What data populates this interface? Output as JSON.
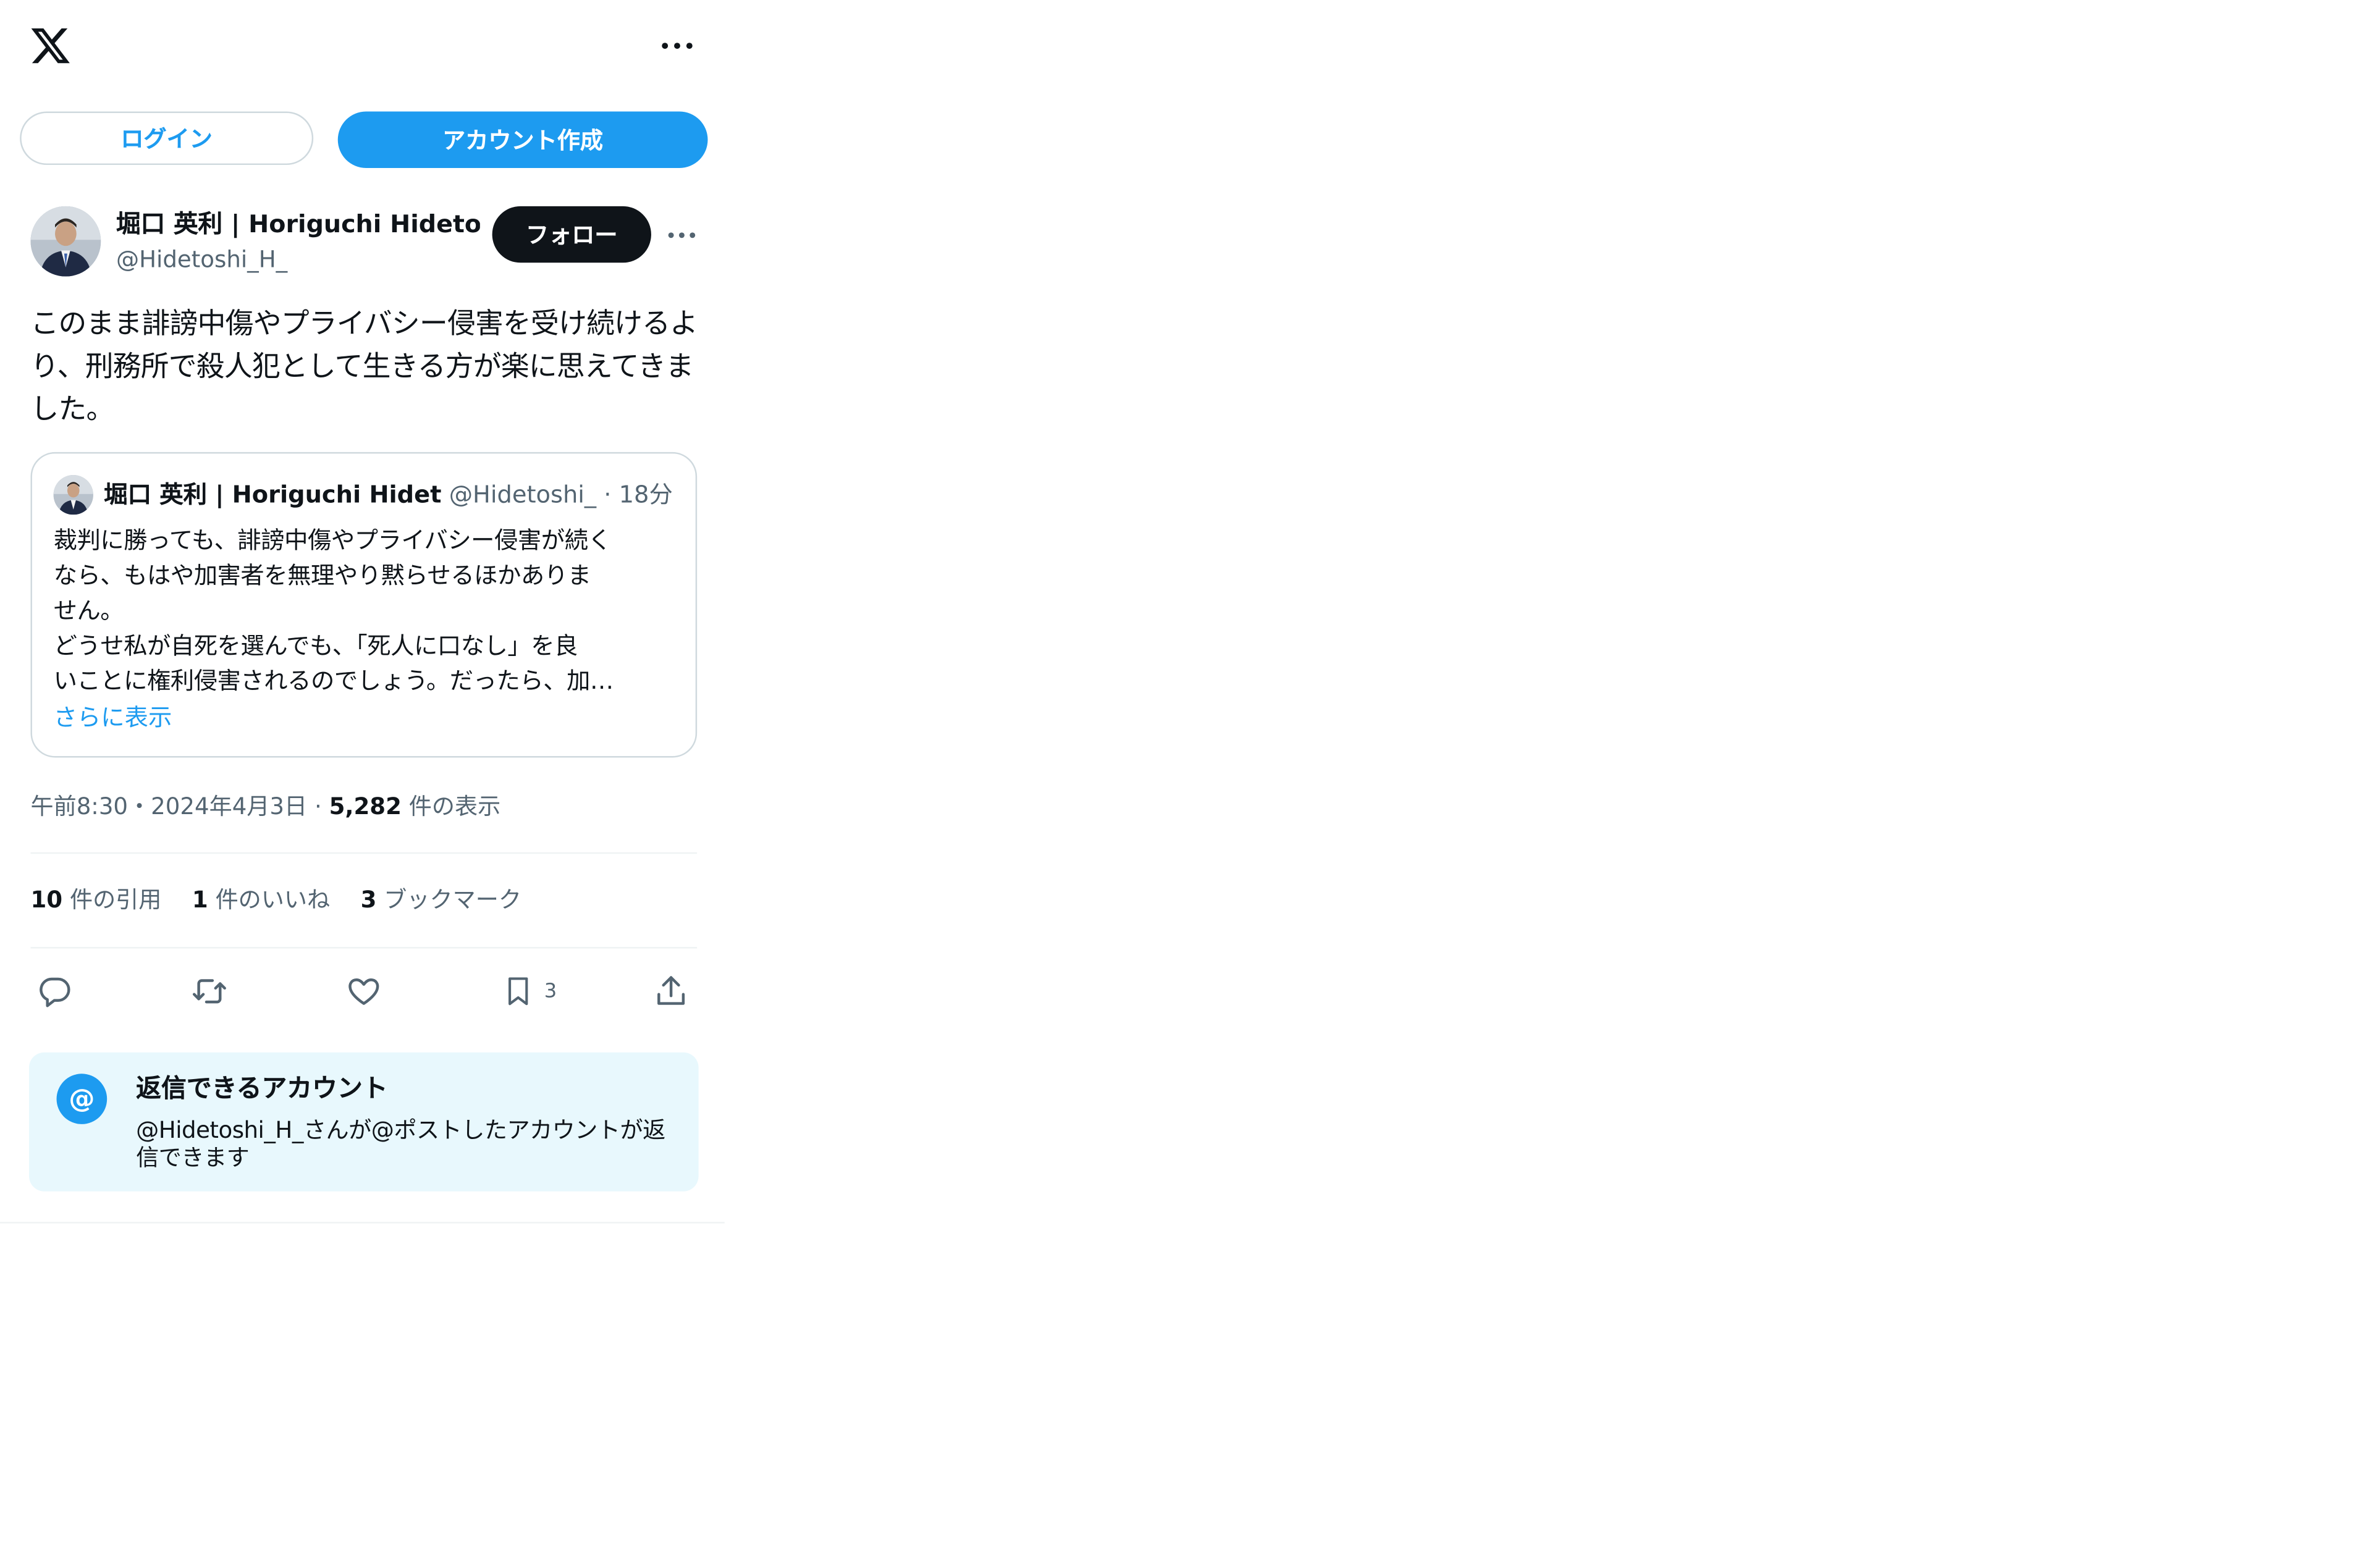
{
  "header": {
    "logo_icon": "x-logo-icon",
    "more_icon": "more-horizontal-icon",
    "login_label": "ログイン",
    "signup_label": "アカウント作成"
  },
  "post": {
    "author_name": "堀口 英利 | Horiguchi Hidetos",
    "author_handle": "@Hidetoshi_H_",
    "follow_label": "フォロー",
    "text": "このまま誹謗中傷やプライバシー侵害を受け続けるより、刑務所で殺人犯として生きる方が楽に思えてきました。",
    "timestamp": "午前8:30・2024年4月3日",
    "separator": " · ",
    "views_count": "5,282",
    "views_label": "件の表示"
  },
  "quote": {
    "author_name": "堀口 英利 | Horiguchi Hidet",
    "author_handle": "@Hidetoshi_",
    "dot": " · ",
    "time": "18分",
    "lines": [
      "裁判に勝っても、誹謗中傷やプライバシー侵害が続く",
      "なら、もはや加害者を無理やり黙らせるほかありま",
      "せん。",
      "どうせ私が自死を選んでも、「死人に口なし」を良",
      "いことに権利侵害されるのでしょう。だったら、加…"
    ],
    "show_more": "さらに表示"
  },
  "stats": {
    "quotes_count": "10",
    "quotes_label": "件の引用",
    "likes_count": "1",
    "likes_label": "件のいいね",
    "bookmarks_count": "3",
    "bookmarks_label": "ブックマーク"
  },
  "actions": {
    "reply_icon": "reply-icon",
    "repost_icon": "repost-icon",
    "like_icon": "like-icon",
    "bookmark_icon": "bookmark-icon",
    "bookmark_count": "3",
    "share_icon": "share-icon"
  },
  "reply_notice": {
    "icon_text": "@",
    "title": "返信できるアカウント",
    "body": "@Hidetoshi_H_さんが@ポストしたアカウントが返信できます"
  },
  "colors": {
    "accent": "#1d9bf0",
    "text_primary": "#0f1419",
    "text_secondary": "#536471",
    "border": "#cfd9de",
    "notice_bg": "#e8f8fd"
  }
}
